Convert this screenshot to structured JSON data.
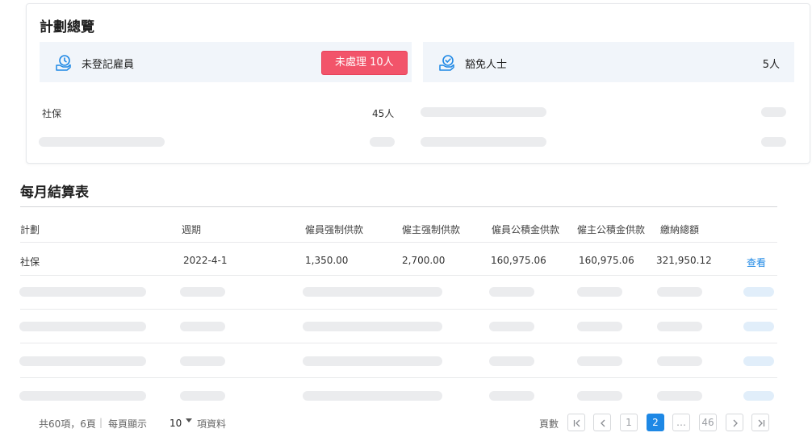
{
  "overview": {
    "title": "計劃總覽",
    "unregistered": {
      "label": "未登記雇員",
      "badge": "未處理  10人"
    },
    "exempt": {
      "label": "豁免人士",
      "count": "5人"
    },
    "social": {
      "label": "社保",
      "count": "45人"
    }
  },
  "settlement": {
    "title": "每月結算表",
    "columns": [
      "計劃",
      "週期",
      "僱員强制供款",
      "僱主强制供款",
      "僱員公積金供款",
      "僱主公積金供款",
      "繳納總額"
    ],
    "row": {
      "plan": "社保",
      "period": "2022-4-1",
      "employee_mpf": "1,350.00",
      "employer_mpf": "2,700.00",
      "employee_pf": "160,975.06",
      "employer_pf": "160,975.06",
      "total": "321,950.12",
      "action": "查看"
    }
  },
  "pagination": {
    "summary": "共60項，6頁",
    "per_page_label": "每頁顯示",
    "per_page_value": "10",
    "per_page_suffix": "項資料",
    "pages_label": "頁數",
    "pages": [
      "1",
      "2",
      "…",
      "46"
    ],
    "current_page": "2"
  },
  "colors": {
    "accent": "#1e88e5",
    "badge": "#f2546a",
    "panel": "#f1f5fa",
    "skeleton": "#ebecee"
  },
  "icons": {
    "unregistered": "hand-clock-icon",
    "exempt": "hand-check-icon"
  }
}
